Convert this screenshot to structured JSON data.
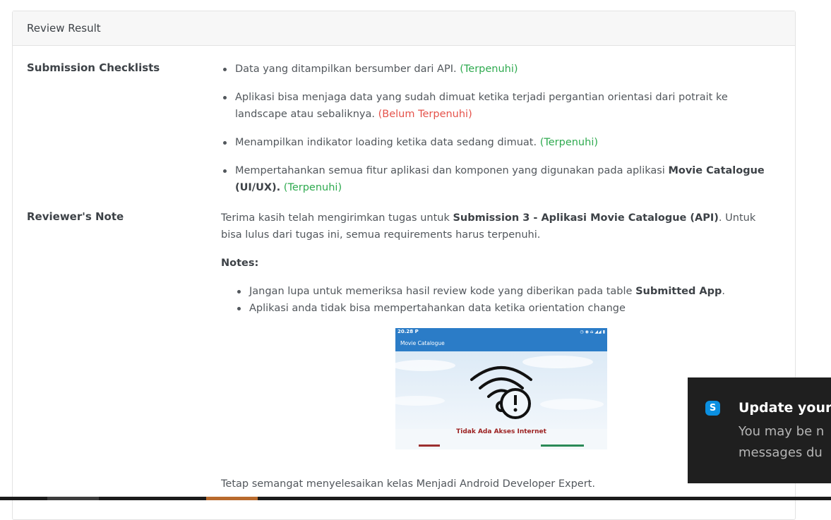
{
  "card": {
    "title": "Review Result"
  },
  "checklist": {
    "label": "Submission Checklists",
    "items": [
      {
        "text": "Data yang ditampilkan bersumber dari API.",
        "status": "(Terpenuhi)"
      },
      {
        "text": "Aplikasi bisa menjaga data yang sudah dimuat ketika terjadi pergantian orientasi dari potrait ke landscape atau sebaliknya.",
        "status": "(Belum Terpenuhi)"
      },
      {
        "text": "Menampilkan indikator loading ketika data sedang dimuat.",
        "status": "(Terpenuhi)"
      },
      {
        "text": "Mempertahankan semua fitur aplikasi dan komponen yang digunakan pada aplikasi",
        "bold": "Movie Catalogue (UI/UX).",
        "status": "(Terpenuhi)"
      }
    ]
  },
  "note": {
    "label": "Reviewer's Note",
    "intro_prefix": "Terima kasih telah mengirimkan tugas untuk",
    "intro_bold": "Submission 3 - Aplikasi Movie Catalogue  (API)",
    "intro_suffix": ". Untuk bisa lulus dari tugas ini, semua requirements harus terpenuhi.",
    "notes_title": "Notes:",
    "notes": [
      {
        "prefix": "Jangan lupa untuk memeriksa hasil review kode yang diberikan pada table",
        "bold": "Submitted App",
        "suffix": "."
      },
      {
        "prefix": "Aplikasi anda tidak bisa mempertahankan data ketika orientation change",
        "bold": "",
        "suffix": ""
      }
    ],
    "closing": "Tetap semangat menyelesaikan kelas Menjadi Android Developer Expert."
  },
  "screenshot": {
    "time": "20.28",
    "app_title": "Movie Catalogue",
    "message": "Tidak Ada Akses Internet"
  },
  "toast": {
    "title": "Update your",
    "body_line1": "You may be n",
    "body_line2": "messages du"
  },
  "colors": {
    "ok": "#2eaa4f",
    "bad": "#e5524a",
    "appbar": "#2b7cc7",
    "toast_bg": "#1f1f1f"
  }
}
